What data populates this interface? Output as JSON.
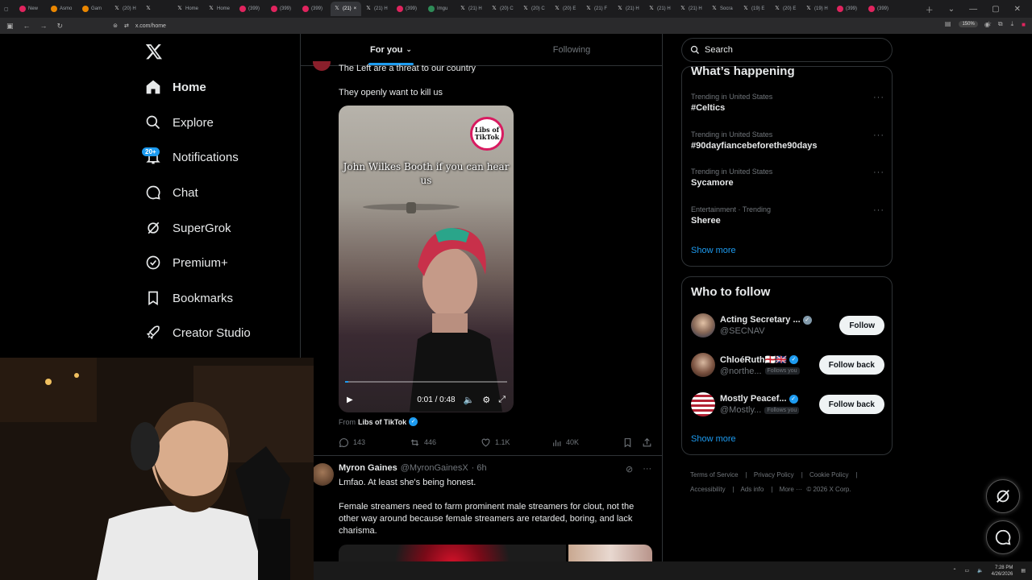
{
  "browser": {
    "tabs": [
      {
        "label": "New",
        "fav": "yt"
      },
      {
        "label": "Asmo",
        "fav": "g"
      },
      {
        "label": "Gam",
        "fav": "g"
      },
      {
        "label": "(20) H",
        "fav": "x"
      },
      {
        "label": "",
        "fav": "x"
      },
      {
        "label": "Home",
        "fav": "x"
      },
      {
        "label": "Home",
        "fav": "x"
      },
      {
        "label": "(399)",
        "fav": "yt"
      },
      {
        "label": "(399)",
        "fav": "yt"
      },
      {
        "label": "(399)",
        "fav": "yt"
      },
      {
        "label": "(21)",
        "fav": "x",
        "active": true
      },
      {
        "label": "(21) H",
        "fav": "x"
      },
      {
        "label": "(399)",
        "fav": "yt"
      },
      {
        "label": "Imgu",
        "fav": "gr"
      },
      {
        "label": "(21) H",
        "fav": "x"
      },
      {
        "label": "(20) C",
        "fav": "x"
      },
      {
        "label": "(20) C",
        "fav": "x"
      },
      {
        "label": "(20) E",
        "fav": "x"
      },
      {
        "label": "(21) F",
        "fav": "x"
      },
      {
        "label": "(21) H",
        "fav": "x"
      },
      {
        "label": "(21) H",
        "fav": "x"
      },
      {
        "label": "(21) H",
        "fav": "x"
      },
      {
        "label": "Socra",
        "fav": "x"
      },
      {
        "label": "(19) E",
        "fav": "x"
      },
      {
        "label": "(20) E",
        "fav": "x"
      },
      {
        "label": "(19) H",
        "fav": "x"
      },
      {
        "label": "(399)",
        "fav": "yt"
      },
      {
        "label": "(399)",
        "fav": "yt"
      }
    ],
    "url": "x.com/home",
    "zoom": "150%"
  },
  "nav": {
    "home": "Home",
    "explore": "Explore",
    "notifications": "Notifications",
    "notifications_badge": "20+",
    "chat": "Chat",
    "supergrok": "SuperGrok",
    "premium": "Premium+",
    "bookmarks": "Bookmarks",
    "creator_studio": "Creator Studio"
  },
  "feed": {
    "tabs": [
      {
        "label": "For you",
        "active": true
      },
      {
        "label": "Following",
        "active": false
      }
    ],
    "tweet1": {
      "line1": "The Left are a threat to our country",
      "line2": "They openly want to kill us",
      "video": {
        "caption": "John Wilkes Booth if you can hear us",
        "watermark_line1": "Libs of",
        "watermark_line2": "TikTok",
        "time": "0:01 / 0:48",
        "progress": 0.02
      },
      "from_label": "From",
      "from_account": "Libs of TikTok",
      "stats": {
        "replies": "143",
        "reposts": "446",
        "likes": "1.1K",
        "views": "40K"
      }
    },
    "tweet2": {
      "author": "Myron Gaines",
      "handle": "@MyronGainesX",
      "time": "· 6h",
      "line1": "Lmfao. At least she's being honest.",
      "line2": "Female streamers need to farm prominent male streamers for clout, not the other way around because female streamers are retarded, boring, and lack charisma."
    }
  },
  "right": {
    "search_placeholder": "Search",
    "whats_happening": {
      "title": "What’s happening",
      "trends": [
        {
          "context": "Trending in United States",
          "name": "#Celtics"
        },
        {
          "context": "Trending in United States",
          "name": "#90dayfiancebeforethe90days"
        },
        {
          "context": "Trending in United States",
          "name": "Sycamore"
        },
        {
          "context": "Entertainment · Trending",
          "name": "Sheree"
        }
      ],
      "show_more": "Show more"
    },
    "who_to_follow": {
      "title": "Who to follow",
      "accounts": [
        {
          "name": "Acting Secretary ...",
          "handle": "@SECNAV",
          "follows_you": "",
          "button": "Follow"
        },
        {
          "name": "ChloéRuth🏴󠁧󠁢󠁥󠁮󠁧󠁿🇬🇧",
          "handle": "@northe...",
          "follows_you": "Follows you",
          "button": "Follow back"
        },
        {
          "name": "Mostly Peacef...",
          "handle": "@Mostly...",
          "follows_you": "Follows you",
          "button": "Follow back"
        }
      ],
      "show_more": "Show more"
    },
    "footer": {
      "terms": "Terms of Service",
      "privacy": "Privacy Policy",
      "cookie": "Cookie Policy",
      "accessibility": "Accessibility",
      "ads": "Ads info",
      "more": "More ···",
      "copyright": "© 2026 X Corp."
    }
  },
  "taskbar": {
    "time": "7:28 PM",
    "date": "4/26/2026"
  },
  "colors": {
    "accent": "#1d9bf0",
    "background": "#000000",
    "border": "#2f3336",
    "muted": "#71767b"
  }
}
